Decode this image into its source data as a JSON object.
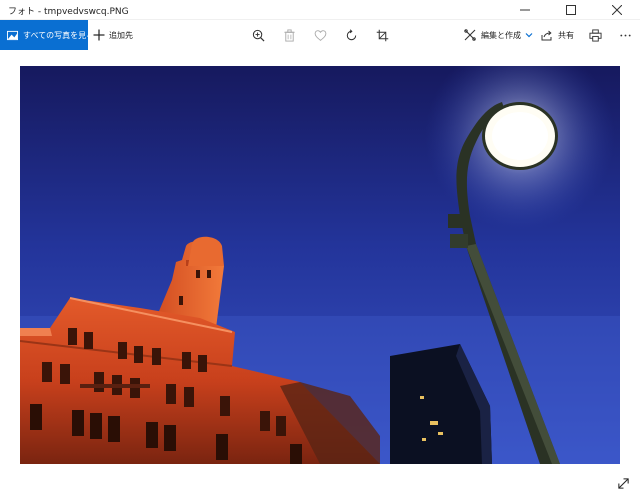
{
  "window": {
    "title": "フォト - tmpvedvswcq.PNG"
  },
  "toolbar": {
    "all_photos_label": "すべての写真を見る",
    "add_to_label": "追加先",
    "edit_create_label": "編集と作成",
    "share_label": "共有"
  },
  "icons": {
    "zoom": "zoom-in-icon",
    "delete": "trash-icon",
    "favorite": "heart-icon",
    "rotate": "rotate-icon",
    "crop": "crop-icon",
    "print": "printer-icon",
    "more": "more-icon",
    "fullscreen": "expand-icon"
  },
  "colors": {
    "accent": "#0a6fd2"
  }
}
